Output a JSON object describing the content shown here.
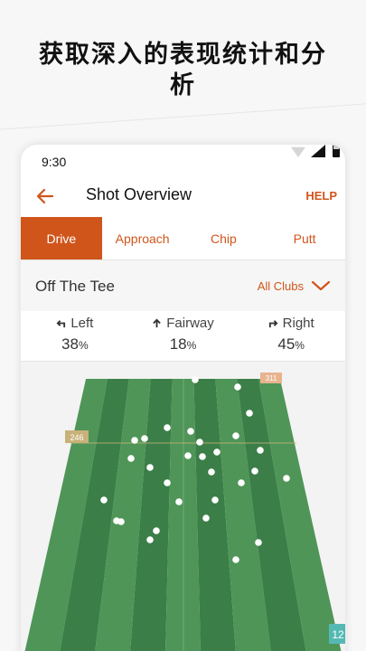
{
  "headline": "获取深入的表现统计和分析",
  "status": {
    "time": "9:30"
  },
  "appbar": {
    "title": "Shot Overview",
    "help": "HELP"
  },
  "tabs": [
    {
      "label": "Drive",
      "active": true
    },
    {
      "label": "Approach",
      "active": false
    },
    {
      "label": "Chip",
      "active": false
    },
    {
      "label": "Putt",
      "active": false
    }
  ],
  "section": {
    "title": "Off The Tee",
    "club_filter": "All Clubs"
  },
  "stats": {
    "left": {
      "label": "Left",
      "value": "38",
      "unit": "%"
    },
    "fairway": {
      "label": "Fairway",
      "value": "18",
      "unit": "%"
    },
    "right": {
      "label": "Right",
      "value": "45",
      "unit": "%"
    }
  },
  "field": {
    "marker_left": "246",
    "marker_top": "311",
    "marker_bottom": "12",
    "colors": {
      "light": "#4f9558",
      "dark": "#3b7e48",
      "accent": "#d0551b",
      "marker_teal": "#55b9b3"
    }
  }
}
